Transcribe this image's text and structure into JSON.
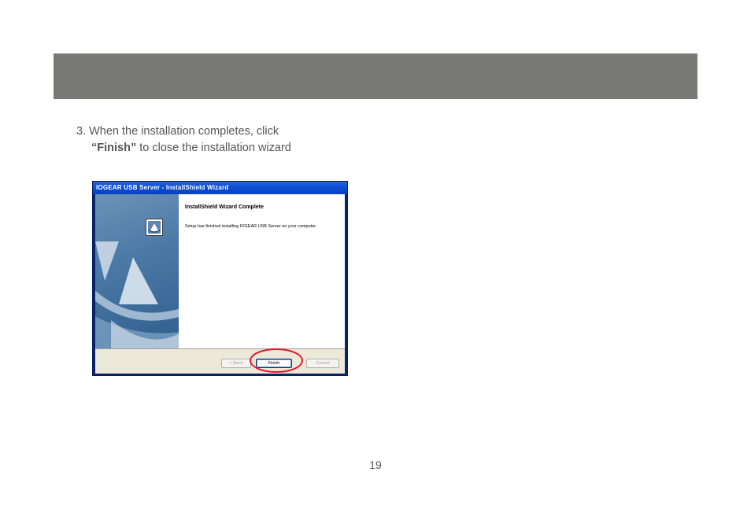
{
  "step": {
    "line1": "3. When the installation completes, click",
    "finish_word": "“Finish”",
    "line2_rest": " to close the installation wizard"
  },
  "window": {
    "title": "IOGEAR USB Server - InstallShield Wizard",
    "heading": "InstallShield Wizard Complete",
    "message": "Setup has finished installing IOGEAR USB Server on your computer.",
    "buttons": {
      "back": "< Back",
      "finish": "Finish",
      "cancel": "Cancel"
    }
  },
  "page_number": "19",
  "colors": {
    "header_band": "#787876",
    "highlight_circle": "#e3152b",
    "title_bar": "#0a4fd6"
  }
}
